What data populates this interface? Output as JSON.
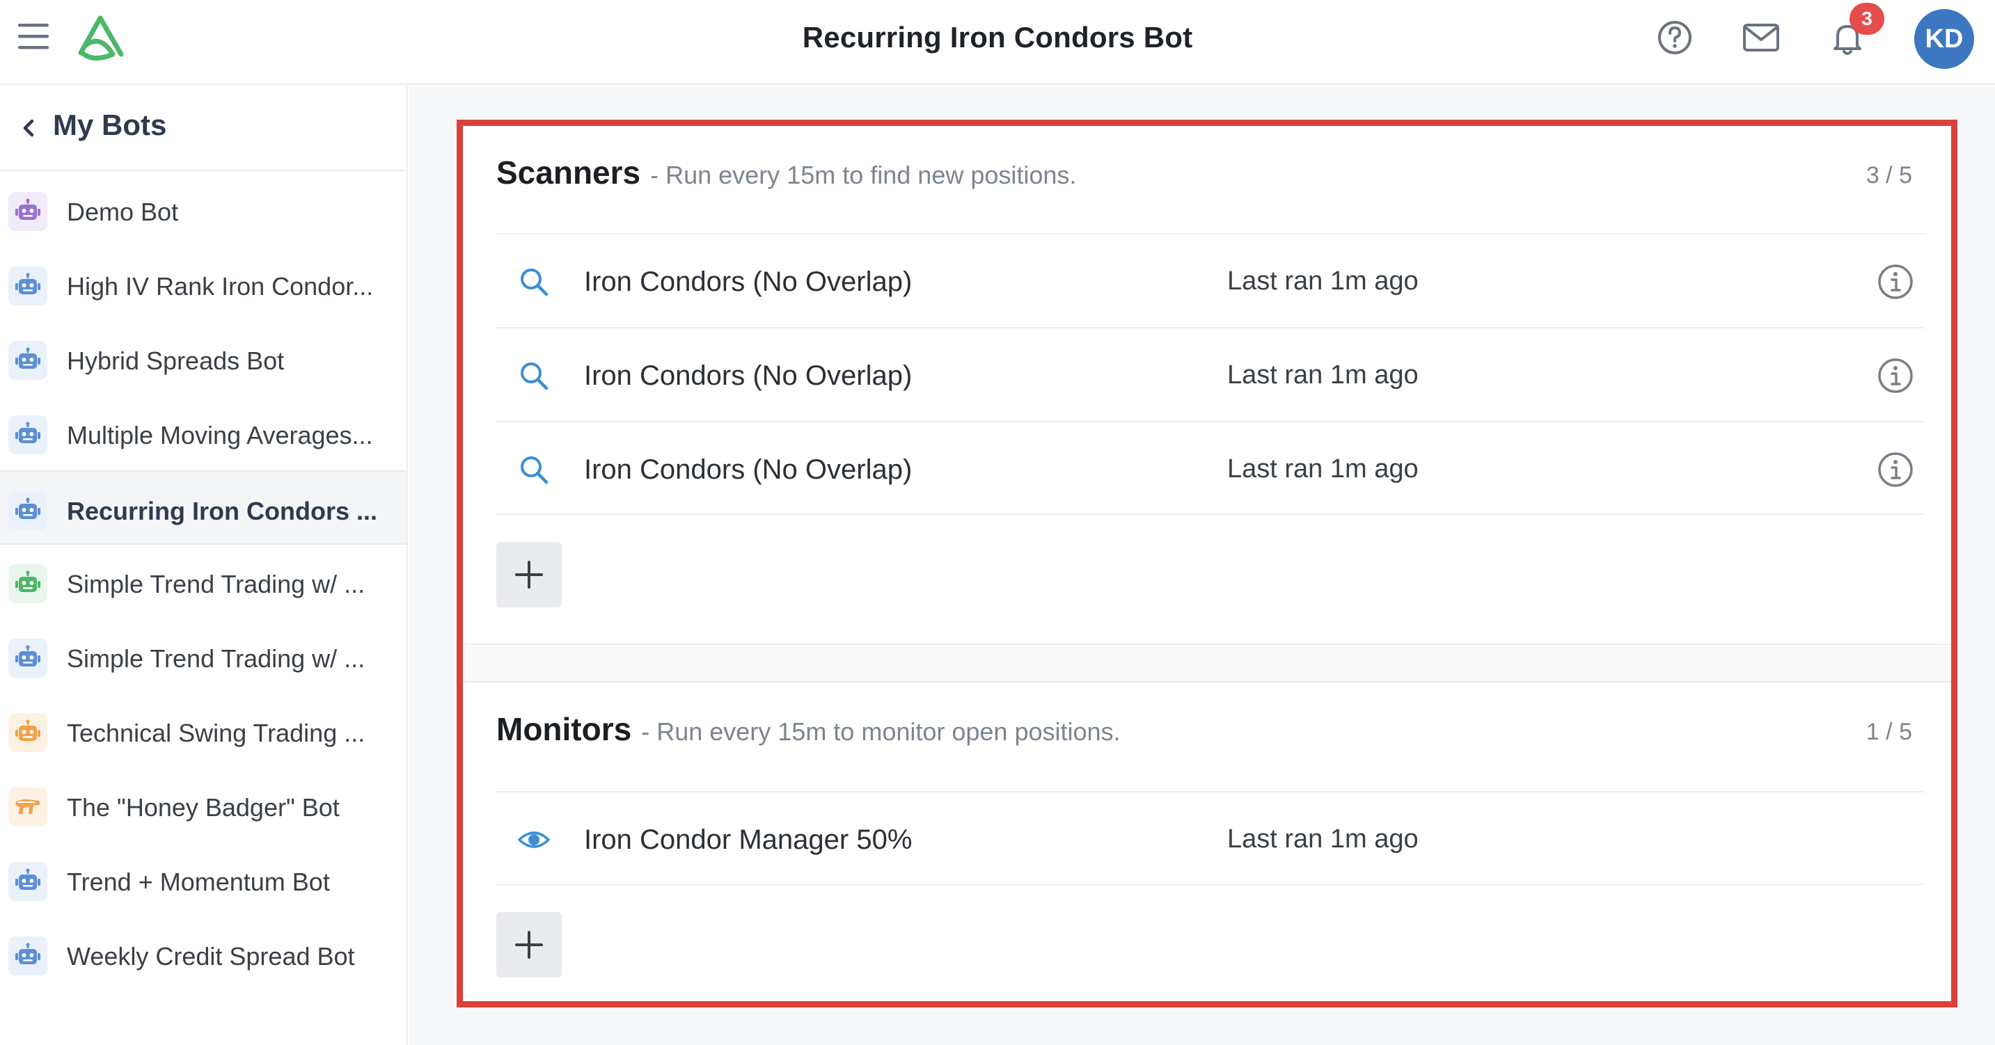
{
  "header": {
    "title": "Recurring Iron Condors Bot",
    "notification_count": "3",
    "avatar_initials": "KD",
    "brand_color": "#4cb868"
  },
  "sidebar": {
    "back_label": "My Bots",
    "items": [
      {
        "label": "Demo Bot",
        "icon": "robot-icon",
        "color": "#9b6fd1",
        "bg": "#f1ebfa",
        "active": false
      },
      {
        "label": "High IV Rank Iron Condor...",
        "icon": "robot-icon",
        "color": "#5b8fd6",
        "bg": "#eaf1fb",
        "active": false
      },
      {
        "label": "Hybrid Spreads Bot",
        "icon": "robot-icon",
        "color": "#5b8fd6",
        "bg": "#eaf1fb",
        "active": false
      },
      {
        "label": "Multiple Moving Averages...",
        "icon": "robot-icon",
        "color": "#5b8fd6",
        "bg": "#eaf1fb",
        "active": false
      },
      {
        "label": "Recurring Iron Condors ...",
        "icon": "robot-icon",
        "color": "#5b8fd6",
        "bg": "#eaf1fb",
        "active": true
      },
      {
        "label": "Simple Trend Trading w/ ...",
        "icon": "robot-icon",
        "color": "#4cb868",
        "bg": "#e8f6ec",
        "active": false
      },
      {
        "label": "Simple Trend Trading w/ ...",
        "icon": "robot-icon",
        "color": "#5b8fd6",
        "bg": "#eaf1fb",
        "active": false
      },
      {
        "label": "Technical Swing Trading ...",
        "icon": "robot-icon",
        "color": "#f2a24a",
        "bg": "#fdf1e3",
        "active": false
      },
      {
        "label": "The \"Honey Badger\" Bot",
        "icon": "honey-badger-icon",
        "color": "#f2a24a",
        "bg": "#fdf1e3",
        "active": false
      },
      {
        "label": "Trend + Momentum Bot",
        "icon": "robot-icon",
        "color": "#5b8fd6",
        "bg": "#eaf1fb",
        "active": false
      },
      {
        "label": "Weekly Credit Spread Bot",
        "icon": "robot-icon",
        "color": "#5b8fd6",
        "bg": "#eaf1fb",
        "active": false
      }
    ]
  },
  "scanners": {
    "title": "Scanners",
    "description": "- Run every 15m to find new positions.",
    "count": "3 / 5",
    "rows": [
      {
        "name": "Iron Condors (No Overlap)",
        "status": "Last ran 1m ago",
        "icon": "search-icon"
      },
      {
        "name": "Iron Condors (No Overlap)",
        "status": "Last ran 1m ago",
        "icon": "search-icon"
      },
      {
        "name": "Iron Condors (No Overlap)",
        "status": "Last ran 1m ago",
        "icon": "search-icon"
      }
    ]
  },
  "monitors": {
    "title": "Monitors",
    "description": "- Run every 15m to monitor open positions.",
    "count": "1 / 5",
    "rows": [
      {
        "name": "Iron Condor Manager 50%",
        "status": "Last ran 1m ago",
        "icon": "eye-icon"
      }
    ]
  },
  "colors": {
    "highlight": "#d9413a",
    "icon_blue": "#3b8fd4",
    "badge": "#e74c4c",
    "avatar": "#3d77c2"
  }
}
